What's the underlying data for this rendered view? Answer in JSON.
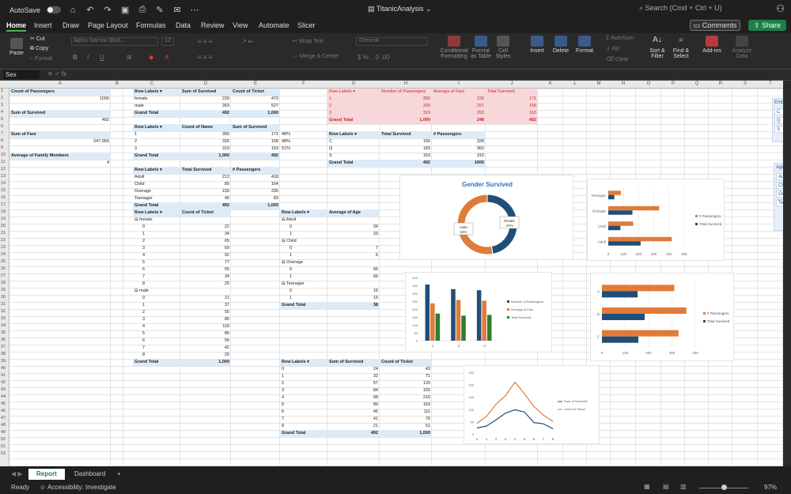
{
  "titlebar": {
    "autosave": "AutoSave",
    "doc_title": "TitanicAnalysis",
    "search_placeholder": "Search (Cmd + Ctrl + U)"
  },
  "menu": [
    "Home",
    "Insert",
    "Draw",
    "Page Layout",
    "Formulas",
    "Data",
    "Review",
    "View",
    "Automate",
    "Slicer"
  ],
  "buttons": {
    "comments": "Comments",
    "share": "Share"
  },
  "ribbon": {
    "paste": "Paste",
    "cut": "Cut",
    "copy": "Copy",
    "format": "Format",
    "font": "Aptos Narrow (Bod...",
    "font_size": "12",
    "wrap_text": "Wrap Text",
    "merge": "Merge & Center",
    "number_format": "General",
    "conditional": "Conditional Formatting",
    "format_table": "Format as Table",
    "cell_styles": "Cell Styles",
    "insert": "Insert",
    "delete": "Delete",
    "format_cells": "Format",
    "autosum": "AutoSum",
    "fill": "Fill",
    "clear": "Clear",
    "sort_filter": "Sort & Filter",
    "find_select": "Find & Select",
    "addins": "Add-ins",
    "analyze": "Analyze Data"
  },
  "formula": {
    "namebox": "Sex",
    "fx": "fx"
  },
  "columns": [
    "A",
    "B",
    "C",
    "D",
    "E",
    "F",
    "G",
    "H",
    "I",
    "J",
    "K",
    "L",
    "M",
    "N",
    "O",
    "P",
    "Q",
    "R",
    "S",
    "T"
  ],
  "rows": [
    "1",
    "2",
    "3",
    "4",
    "5",
    "6",
    "7",
    "8",
    "9",
    "10",
    "11",
    "12",
    "13",
    "14",
    "15",
    "16",
    "17",
    "18",
    "19",
    "20",
    "21",
    "22",
    "23",
    "24",
    "25",
    "26",
    "27",
    "28",
    "29",
    "30",
    "31",
    "32",
    "33",
    "34",
    "35",
    "36",
    "37",
    "38",
    "39",
    "40",
    "41",
    "42",
    "43",
    "44",
    "45",
    "46",
    "47",
    "48",
    "49",
    "50",
    "51",
    "52"
  ],
  "summary": {
    "count_label": "Count of Passengers",
    "count_val": "1000",
    "survived_label": "Sum of Survived",
    "survived_val": "492",
    "fare_label": "Sum of Fare",
    "fare_val": "247,969",
    "family_label": "Average of Family Members",
    "family_val": "4"
  },
  "pivot_sex": {
    "headers": [
      "Row Labels",
      "Sum of Survived",
      "Count of Ticket"
    ],
    "rows": [
      [
        "female",
        "229",
        "473"
      ],
      [
        "male",
        "263",
        "527"
      ],
      [
        "Grand Total",
        "492",
        "1,000"
      ]
    ]
  },
  "pivot_class": {
    "headers": [
      "Row Labels",
      "Count of Name",
      "Sum of Survived"
    ],
    "rows": [
      [
        "1",
        "355",
        "171",
        "48%"
      ],
      [
        "2",
        "326",
        "158",
        "48%"
      ],
      [
        "3",
        "319",
        "163",
        "51%"
      ],
      [
        "Grand Total",
        "1,000",
        "492",
        ""
      ]
    ]
  },
  "pivot_age": {
    "headers": [
      "Row Labels",
      "Total Survived",
      "# Passengers"
    ],
    "rows": [
      [
        "Adult",
        "213",
        "418"
      ],
      [
        "Child",
        "80",
        "164"
      ],
      [
        "Overage",
        "159",
        "335"
      ],
      [
        "Teenager",
        "40",
        "83"
      ],
      [
        "Grand Total",
        "492",
        "1,000"
      ]
    ]
  },
  "pivot_ticket": {
    "headers": [
      "Row Labels",
      "Count of Ticket"
    ],
    "rows": [
      [
        "⊟ female",
        ""
      ],
      [
        "0",
        "22"
      ],
      [
        "1",
        "34"
      ],
      [
        "2",
        "65"
      ],
      [
        "3",
        "69"
      ],
      [
        "4",
        "92"
      ],
      [
        "5",
        "77"
      ],
      [
        "6",
        "55"
      ],
      [
        "7",
        "34"
      ],
      [
        "8",
        "25"
      ],
      [
        "⊟ male",
        ""
      ],
      [
        "0",
        "21"
      ],
      [
        "1",
        "37"
      ],
      [
        "2",
        "55"
      ],
      [
        "3",
        "86"
      ],
      [
        "4",
        "118"
      ],
      [
        "5",
        "86"
      ],
      [
        "6",
        "56"
      ],
      [
        "7",
        "42"
      ],
      [
        "8",
        "26"
      ],
      [
        "Grand Total",
        "1,000"
      ]
    ]
  },
  "pivot_class2": {
    "headers": [
      "Row Labels",
      "Number of Passengers",
      "Average of Fare",
      "Total Survived"
    ],
    "rows": [
      [
        "1",
        "355",
        "236",
        "171"
      ],
      [
        "2",
        "326",
        "257",
        "158"
      ],
      [
        "3",
        "319",
        "253",
        "163"
      ],
      [
        "Grand Total",
        "1,000",
        "248",
        "492"
      ]
    ]
  },
  "pivot_embark": {
    "headers": [
      "Row Labels",
      "Total Survived",
      "# Passengers"
    ],
    "rows": [
      [
        "C",
        "156",
        "328"
      ],
      [
        "Q",
        "183",
        "362"
      ],
      [
        "S",
        "153",
        "310"
      ],
      [
        "Grand Total",
        "492",
        "1000"
      ]
    ]
  },
  "pivot_avg_age": {
    "headers": [
      "Row Labels",
      "Average of Age"
    ],
    "rows": [
      [
        "⊟ Adult",
        ""
      ],
      [
        "0",
        "34"
      ],
      [
        "1",
        "33"
      ],
      [
        "⊟ Child",
        ""
      ],
      [
        "0",
        "7"
      ],
      [
        "1",
        "6"
      ],
      [
        "⊟ Overage",
        ""
      ],
      [
        "0",
        "66"
      ],
      [
        "1",
        "66"
      ],
      [
        "⊟ Teenager",
        ""
      ],
      [
        "0",
        "16"
      ],
      [
        "1",
        "15"
      ],
      [
        "Grand Total",
        "38"
      ]
    ]
  },
  "pivot_sibsp": {
    "headers": [
      "Row Labels",
      "Sum of Survived",
      "Count of Ticket"
    ],
    "rows": [
      [
        "0",
        "24",
        "43"
      ],
      [
        "1",
        "32",
        "71"
      ],
      [
        "2",
        "57",
        "120"
      ],
      [
        "3",
        "84",
        "155"
      ],
      [
        "4",
        "98",
        "210"
      ],
      [
        "5",
        "89",
        "163"
      ],
      [
        "6",
        "46",
        "111"
      ],
      [
        "7",
        "41",
        "76"
      ],
      [
        "8",
        "21",
        "51"
      ],
      [
        "Grand Total",
        "492",
        "1,000"
      ]
    ]
  },
  "chart_data": [
    {
      "type": "pie",
      "title": "Gender Survived",
      "categories": [
        "female",
        "male"
      ],
      "values": [
        47,
        53
      ],
      "labels": [
        "female\n47%",
        "male\n53%"
      ]
    },
    {
      "type": "bar",
      "orientation": "horizontal",
      "categories": [
        "Adult",
        "Child",
        "Overage",
        "Teenager"
      ],
      "series": [
        {
          "name": "# Passengers",
          "values": [
            418,
            164,
            335,
            83
          ]
        },
        {
          "name": "Total Survived",
          "values": [
            213,
            80,
            159,
            40
          ]
        }
      ],
      "xlim": [
        0,
        500
      ],
      "ticks": [
        "0",
        "100",
        "200",
        "300",
        "400",
        "500"
      ]
    },
    {
      "type": "bar",
      "categories": [
        "1",
        "2",
        "3"
      ],
      "series": [
        {
          "name": "Number of Passengers",
          "values": [
            355,
            326,
            319
          ]
        },
        {
          "name": "Average of Fare",
          "values": [
            236,
            257,
            253
          ]
        },
        {
          "name": "Total Survived",
          "values": [
            171,
            158,
            163
          ]
        }
      ],
      "ylim": [
        0,
        400
      ],
      "ticks": [
        "0",
        "50",
        "100",
        "150",
        "200",
        "250",
        "300",
        "350",
        "400"
      ]
    },
    {
      "type": "bar",
      "orientation": "horizontal",
      "categories": [
        "C",
        "Q",
        "S"
      ],
      "series": [
        {
          "name": "# Passengers",
          "values": [
            328,
            362,
            310
          ]
        },
        {
          "name": "Total Survived",
          "values": [
            156,
            183,
            153
          ]
        }
      ],
      "xlim": [
        0,
        400
      ],
      "ticks": [
        "0",
        "100",
        "200",
        "300",
        "400"
      ]
    },
    {
      "type": "line",
      "x": [
        "0",
        "1",
        "2",
        "3",
        "4",
        "5",
        "6",
        "7",
        "8"
      ],
      "series": [
        {
          "name": "Sum of Survived",
          "values": [
            24,
            32,
            57,
            84,
            98,
            89,
            46,
            41,
            21
          ]
        },
        {
          "name": "Count of Ticket",
          "values": [
            43,
            71,
            120,
            155,
            210,
            163,
            111,
            76,
            51
          ]
        }
      ],
      "ylim": [
        0,
        250
      ],
      "ticks": [
        "0",
        "50",
        "100",
        "150",
        "200",
        "250"
      ]
    }
  ],
  "colors": {
    "blue": "#1f4e79",
    "orange": "#e07b39",
    "green": "#2e7d32",
    "accent": "#1e7e4a"
  },
  "slicers": {
    "embark_title": "Embar",
    "embark_items": [
      "C",
      "Q",
      "S"
    ],
    "age_title": "Age",
    "age_items": [
      "Ad",
      "Ch",
      "Ov",
      "Te"
    ]
  },
  "tabs": {
    "report": "Report",
    "dashboard": "Dashboard",
    "add": "+"
  },
  "status": {
    "ready": "Ready",
    "accessibility": "Accessibility: Investigate",
    "zoom": "97%"
  }
}
